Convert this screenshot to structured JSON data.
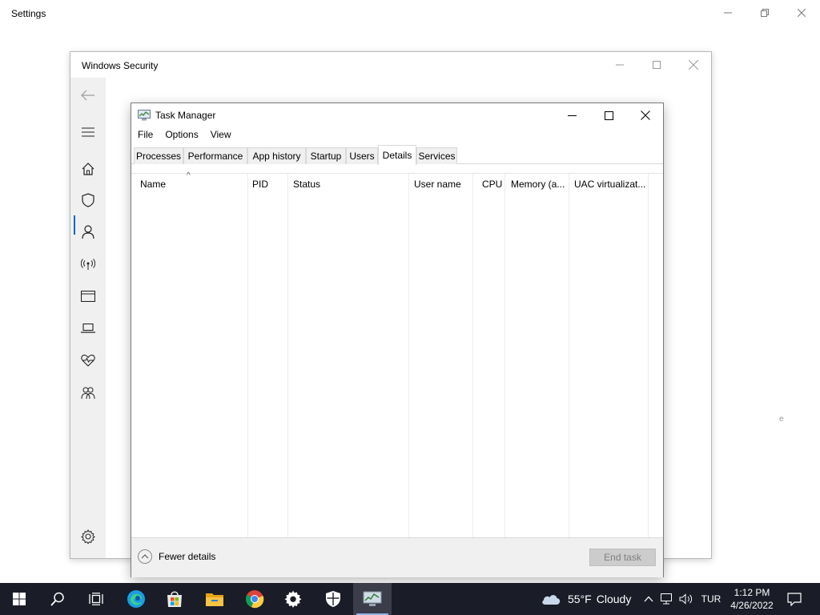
{
  "settings": {
    "title": "Settings"
  },
  "security": {
    "title": "Windows Security",
    "edge_char": "e"
  },
  "task_manager": {
    "title": "Task Manager",
    "menu": [
      "File",
      "Options",
      "View"
    ],
    "tabs": [
      "Processes",
      "Performance",
      "App history",
      "Startup",
      "Users",
      "Details",
      "Services"
    ],
    "active_tab": "Details",
    "columns": [
      "Name",
      "PID",
      "Status",
      "User name",
      "CPU",
      "Memory (a...",
      "UAC virtualizat..."
    ],
    "sort_indicator": "^",
    "fewer_details": "Fewer details",
    "end_task": "End task"
  },
  "taskbar": {
    "weather": {
      "temp": "55°F",
      "condition": "Cloudy"
    },
    "language": "TUR",
    "time": "1:12 PM",
    "date": "4/26/2022",
    "colors": {
      "background": "#1a1c28",
      "accent": "#8cb4e6"
    }
  }
}
